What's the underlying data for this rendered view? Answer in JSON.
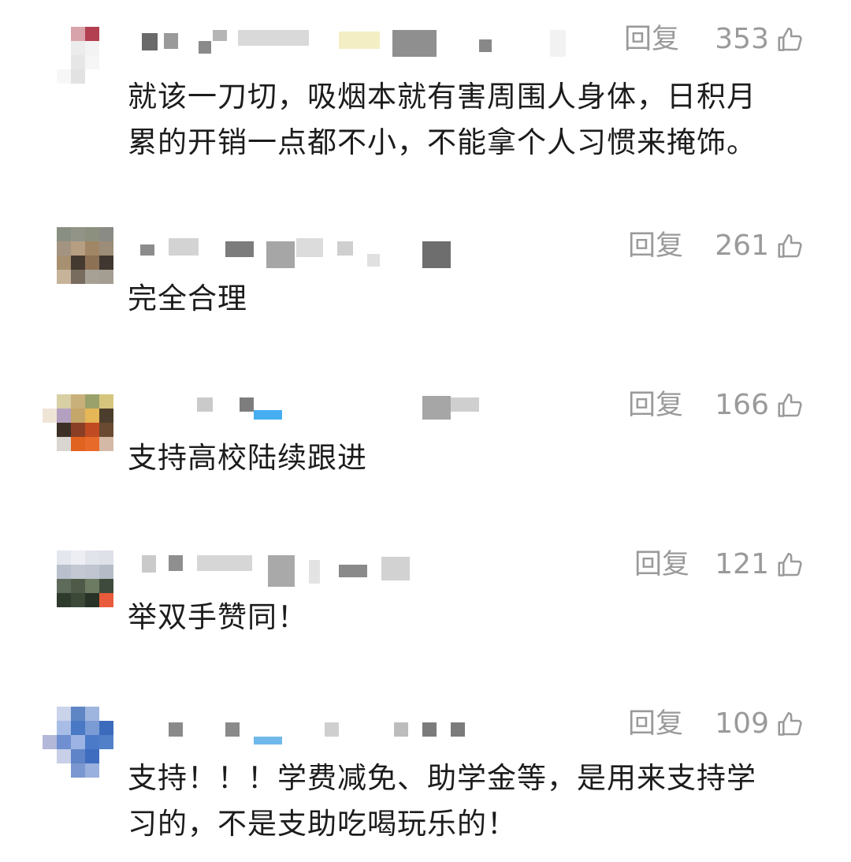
{
  "comments": [
    {
      "reply_label": "回复",
      "like_count": "353",
      "text_lines": [
        "就该一刀切，吸烟本就有害周围人身体，日积月",
        "累的开销一点都不小，不能拿个人习惯来掩饰。"
      ]
    },
    {
      "reply_label": "回复",
      "like_count": "261",
      "text_lines": [
        "完全合理"
      ]
    },
    {
      "reply_label": "回复",
      "like_count": "166",
      "text_lines": [
        "支持高校陆续跟进"
      ]
    },
    {
      "reply_label": "回复",
      "like_count": "121",
      "text_lines": [
        "举双手赞同！"
      ]
    },
    {
      "reply_label": "回复",
      "like_count": "109",
      "text_lines": [
        "支持！！！学费减免、助学金等，是用来支持学",
        "习的，不是支助吃喝玩乐的！"
      ]
    }
  ],
  "icons": {
    "like": "thumbs-up-icon",
    "avatar": "pixelated-avatar",
    "username": "pixelated-username"
  },
  "colors": {
    "meta_text": "#9a9a9a",
    "body_text": "#1c1c1c"
  }
}
